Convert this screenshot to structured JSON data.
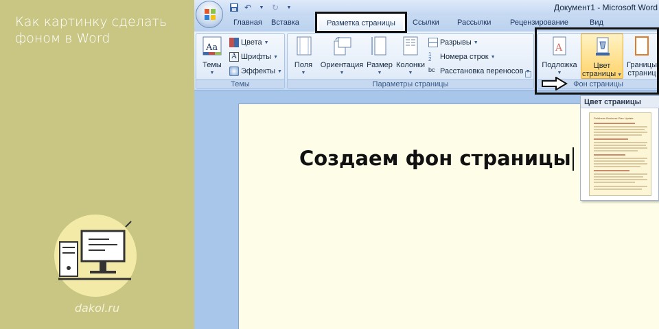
{
  "left_panel": {
    "headline": "Как картинку сделать фоном в Word",
    "site": "dakol.ru"
  },
  "window": {
    "title": "Документ1 - Microsoft Word"
  },
  "tabs": [
    {
      "label": "Главная"
    },
    {
      "label": "Вставка"
    },
    {
      "label": "Разметка страницы",
      "active": true
    },
    {
      "label": "Ссылки"
    },
    {
      "label": "Рассылки"
    },
    {
      "label": "Рецензирование"
    },
    {
      "label": "Вид"
    }
  ],
  "ribbon": {
    "themes": {
      "label": "Темы",
      "big_button": "Темы",
      "colors": "Цвета",
      "fonts": "Шрифты",
      "effects": "Эффекты"
    },
    "page_setup": {
      "label": "Параметры страницы",
      "margins": "Поля",
      "orientation": "Ориентация",
      "size": "Размер",
      "columns": "Колонки",
      "breaks": "Разрывы",
      "line_numbers": "Номера строк",
      "hyphenation": "Расстановка переносов"
    },
    "page_background": {
      "label": "Фон страницы",
      "watermark": "Подложка",
      "page_color_line1": "Цвет",
      "page_color_line2": "страницы",
      "borders_line1": "Границы",
      "borders_line2": "страниц"
    }
  },
  "document": {
    "heading": "Создаем фон страницы",
    "page_color": "#fefde7"
  },
  "popup": {
    "title": "Цвет страницы",
    "thumbnail_heading": "Pelrthean Business Plan Update"
  },
  "colors": {
    "left_panel_bg": "#c9c684",
    "ribbon_blue": "#a8c6ea",
    "highlight_border": "#111111"
  }
}
